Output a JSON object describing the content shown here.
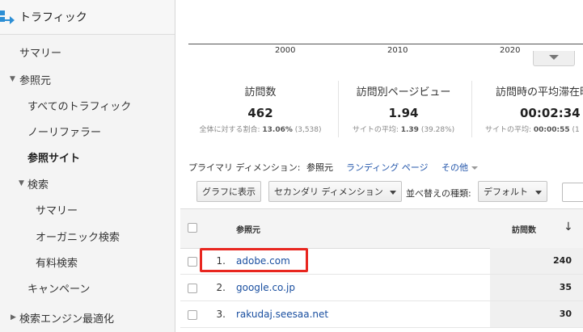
{
  "sidebar": {
    "title": "トラフィック",
    "items": [
      {
        "label": "サマリー"
      },
      {
        "label": "参照元"
      },
      {
        "label": "すべてのトラフィック"
      },
      {
        "label": "ノーリファラー"
      },
      {
        "label": "参照サイト"
      },
      {
        "label": "検索"
      },
      {
        "label": "サマリー"
      },
      {
        "label": "オーガニック検索"
      },
      {
        "label": "有料検索"
      },
      {
        "label": "キャンペーン"
      },
      {
        "label": "検索エンジン最適化"
      }
    ]
  },
  "chart": {
    "x_ticks": [
      "2000",
      "2010",
      "2020"
    ]
  },
  "metrics": [
    {
      "label": "訪問数",
      "value": "462",
      "sub_prefix": "全体に対する割合: ",
      "sub_bold": "13.06%",
      "sub_suffix": " (3,538)"
    },
    {
      "label": "訪問別ページビュー",
      "value": "1.94",
      "sub_prefix": "サイトの平均: ",
      "sub_bold": "1.39",
      "sub_suffix": " (39.28%)"
    },
    {
      "label": "訪問時の平均滞在時",
      "value": "00:02:34",
      "sub_prefix": "サイトの平均: ",
      "sub_bold": "00:00:55",
      "sub_suffix": " (1"
    }
  ],
  "dimension": {
    "label": "プライマリ ディメンション:",
    "current": "参照元",
    "landing_page": "ランディング ページ",
    "other": "その他"
  },
  "toolbar": {
    "graph_button": "グラフに表示",
    "secondary_dimension": "セカンダリ ディメンション",
    "sort_label": "並べ替えの種類:",
    "sort_value": "デフォルト"
  },
  "table": {
    "headers": {
      "source": "参照元",
      "visits": "訪問数"
    },
    "rows": [
      {
        "num": "1.",
        "source": "adobe.com",
        "visits": "240"
      },
      {
        "num": "2.",
        "source": "google.co.jp",
        "visits": "35"
      },
      {
        "num": "3.",
        "source": "rakudaj.seesaa.net",
        "visits": "30"
      }
    ]
  },
  "colors": {
    "link": "#1a4fa0",
    "highlight": "#e8261f",
    "logo": "#2d8fd5"
  }
}
